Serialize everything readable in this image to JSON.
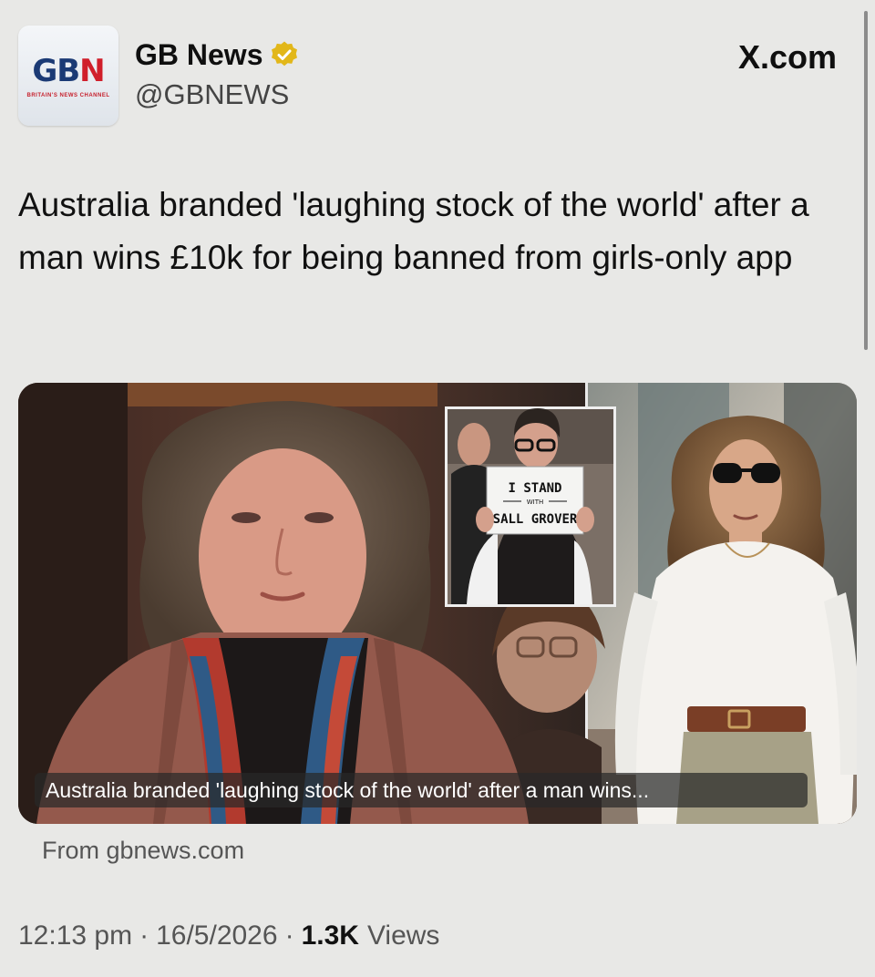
{
  "header": {
    "avatar_logo": "GB N",
    "avatar_logo_prefix": "GB",
    "avatar_logo_accent": "N",
    "avatar_tagline": "BRITAIN'S NEWS CHANNEL",
    "display_name": "GB News",
    "handle": "@GBNEWS",
    "source": "X.com",
    "verified_icon": "verified-badge-gold-icon"
  },
  "post": {
    "headline": "Australia branded 'laughing stock of the world' after a man wins £10k for being banned from girls-only app"
  },
  "media": {
    "sign_line1": "I STAND",
    "sign_line2": "WITH",
    "sign_line3": "SALL GROVER",
    "caption": "Australia branded 'laughing stock of the world' after a man wins...",
    "link_source": "From gbnews.com"
  },
  "meta": {
    "time": "12:13 pm",
    "separator": "·",
    "date": "16/5/2026",
    "views_count": "1.3K",
    "views_label": "Views"
  },
  "colors": {
    "background": "#e8e8e6",
    "brand_blue": "#1b3a75",
    "brand_red": "#d01e2a",
    "verified_gold": "#e2b719"
  }
}
